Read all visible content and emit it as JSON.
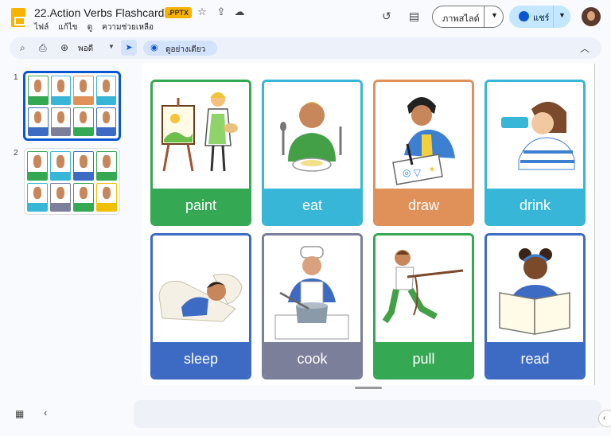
{
  "header": {
    "doc_title": "22.Action Verbs Flashcards",
    "file_badge": ".PPTX",
    "menus": [
      "ไฟล์",
      "แก้ไข",
      "ดู",
      "ความช่วยเหลือ"
    ],
    "slideshow_label": "ภาพสไลด์",
    "share_label": "แชร์"
  },
  "toolbar": {
    "zoom_label": "พอดี",
    "view_mode_label": "ดูอย่างเดียว"
  },
  "filmstrip": {
    "slides": [
      {
        "number": "1",
        "selected": true
      },
      {
        "number": "2",
        "selected": false
      }
    ],
    "slide1_cards": [
      {
        "color": "#34a853"
      },
      {
        "color": "#38b6d8"
      },
      {
        "color": "#e0915a"
      },
      {
        "color": "#38b6d8"
      },
      {
        "color": "#3d6bc4"
      },
      {
        "color": "#7c7f99"
      },
      {
        "color": "#34a853"
      },
      {
        "color": "#3d6bc4"
      }
    ],
    "slide2_cards": [
      {
        "color": "#34a853"
      },
      {
        "color": "#38b6d8"
      },
      {
        "color": "#3d6bc4"
      },
      {
        "color": "#34a853"
      },
      {
        "color": "#38b6d8"
      },
      {
        "color": "#7c7f99"
      },
      {
        "color": "#34a853"
      },
      {
        "color": "#f0c000"
      }
    ]
  },
  "slide": {
    "cards": [
      {
        "word": "paint",
        "color": "#34a853",
        "icon": "painter-icon"
      },
      {
        "word": "eat",
        "color": "#38b6d8",
        "icon": "eating-icon"
      },
      {
        "word": "draw",
        "color": "#e0915a",
        "icon": "drawing-icon"
      },
      {
        "word": "drink",
        "color": "#38b6d8",
        "icon": "drinking-icon"
      },
      {
        "word": "sleep",
        "color": "#3d6bc4",
        "icon": "sleeping-icon"
      },
      {
        "word": "cook",
        "color": "#7c7f99",
        "icon": "cooking-icon"
      },
      {
        "word": "pull",
        "color": "#34a853",
        "icon": "pulling-icon"
      },
      {
        "word": "read",
        "color": "#3d6bc4",
        "icon": "reading-icon"
      }
    ]
  }
}
